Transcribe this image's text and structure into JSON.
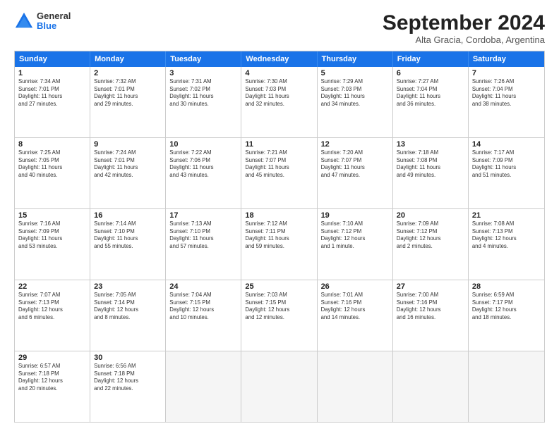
{
  "logo": {
    "general": "General",
    "blue": "Blue"
  },
  "title": "September 2024",
  "subtitle": "Alta Gracia, Cordoba, Argentina",
  "header_days": [
    "Sunday",
    "Monday",
    "Tuesday",
    "Wednesday",
    "Thursday",
    "Friday",
    "Saturday"
  ],
  "weeks": [
    [
      {
        "day": "1",
        "lines": [
          "Sunrise: 7:34 AM",
          "Sunset: 7:01 PM",
          "Daylight: 11 hours",
          "and 27 minutes."
        ]
      },
      {
        "day": "2",
        "lines": [
          "Sunrise: 7:32 AM",
          "Sunset: 7:01 PM",
          "Daylight: 11 hours",
          "and 29 minutes."
        ]
      },
      {
        "day": "3",
        "lines": [
          "Sunrise: 7:31 AM",
          "Sunset: 7:02 PM",
          "Daylight: 11 hours",
          "and 30 minutes."
        ]
      },
      {
        "day": "4",
        "lines": [
          "Sunrise: 7:30 AM",
          "Sunset: 7:03 PM",
          "Daylight: 11 hours",
          "and 32 minutes."
        ]
      },
      {
        "day": "5",
        "lines": [
          "Sunrise: 7:29 AM",
          "Sunset: 7:03 PM",
          "Daylight: 11 hours",
          "and 34 minutes."
        ]
      },
      {
        "day": "6",
        "lines": [
          "Sunrise: 7:27 AM",
          "Sunset: 7:04 PM",
          "Daylight: 11 hours",
          "and 36 minutes."
        ]
      },
      {
        "day": "7",
        "lines": [
          "Sunrise: 7:26 AM",
          "Sunset: 7:04 PM",
          "Daylight: 11 hours",
          "and 38 minutes."
        ]
      }
    ],
    [
      {
        "day": "8",
        "lines": [
          "Sunrise: 7:25 AM",
          "Sunset: 7:05 PM",
          "Daylight: 11 hours",
          "and 40 minutes."
        ]
      },
      {
        "day": "9",
        "lines": [
          "Sunrise: 7:24 AM",
          "Sunset: 7:01 PM",
          "Daylight: 11 hours",
          "and 42 minutes."
        ]
      },
      {
        "day": "10",
        "lines": [
          "Sunrise: 7:22 AM",
          "Sunset: 7:06 PM",
          "Daylight: 11 hours",
          "and 43 minutes."
        ]
      },
      {
        "day": "11",
        "lines": [
          "Sunrise: 7:21 AM",
          "Sunset: 7:07 PM",
          "Daylight: 11 hours",
          "and 45 minutes."
        ]
      },
      {
        "day": "12",
        "lines": [
          "Sunrise: 7:20 AM",
          "Sunset: 7:07 PM",
          "Daylight: 11 hours",
          "and 47 minutes."
        ]
      },
      {
        "day": "13",
        "lines": [
          "Sunrise: 7:18 AM",
          "Sunset: 7:08 PM",
          "Daylight: 11 hours",
          "and 49 minutes."
        ]
      },
      {
        "day": "14",
        "lines": [
          "Sunrise: 7:17 AM",
          "Sunset: 7:09 PM",
          "Daylight: 11 hours",
          "and 51 minutes."
        ]
      }
    ],
    [
      {
        "day": "15",
        "lines": [
          "Sunrise: 7:16 AM",
          "Sunset: 7:09 PM",
          "Daylight: 11 hours",
          "and 53 minutes."
        ]
      },
      {
        "day": "16",
        "lines": [
          "Sunrise: 7:14 AM",
          "Sunset: 7:10 PM",
          "Daylight: 11 hours",
          "and 55 minutes."
        ]
      },
      {
        "day": "17",
        "lines": [
          "Sunrise: 7:13 AM",
          "Sunset: 7:10 PM",
          "Daylight: 11 hours",
          "and 57 minutes."
        ]
      },
      {
        "day": "18",
        "lines": [
          "Sunrise: 7:12 AM",
          "Sunset: 7:11 PM",
          "Daylight: 11 hours",
          "and 59 minutes."
        ]
      },
      {
        "day": "19",
        "lines": [
          "Sunrise: 7:10 AM",
          "Sunset: 7:12 PM",
          "Daylight: 12 hours",
          "and 1 minute."
        ]
      },
      {
        "day": "20",
        "lines": [
          "Sunrise: 7:09 AM",
          "Sunset: 7:12 PM",
          "Daylight: 12 hours",
          "and 2 minutes."
        ]
      },
      {
        "day": "21",
        "lines": [
          "Sunrise: 7:08 AM",
          "Sunset: 7:13 PM",
          "Daylight: 12 hours",
          "and 4 minutes."
        ]
      }
    ],
    [
      {
        "day": "22",
        "lines": [
          "Sunrise: 7:07 AM",
          "Sunset: 7:13 PM",
          "Daylight: 12 hours",
          "and 6 minutes."
        ]
      },
      {
        "day": "23",
        "lines": [
          "Sunrise: 7:05 AM",
          "Sunset: 7:14 PM",
          "Daylight: 12 hours",
          "and 8 minutes."
        ]
      },
      {
        "day": "24",
        "lines": [
          "Sunrise: 7:04 AM",
          "Sunset: 7:15 PM",
          "Daylight: 12 hours",
          "and 10 minutes."
        ]
      },
      {
        "day": "25",
        "lines": [
          "Sunrise: 7:03 AM",
          "Sunset: 7:15 PM",
          "Daylight: 12 hours",
          "and 12 minutes."
        ]
      },
      {
        "day": "26",
        "lines": [
          "Sunrise: 7:01 AM",
          "Sunset: 7:16 PM",
          "Daylight: 12 hours",
          "and 14 minutes."
        ]
      },
      {
        "day": "27",
        "lines": [
          "Sunrise: 7:00 AM",
          "Sunset: 7:16 PM",
          "Daylight: 12 hours",
          "and 16 minutes."
        ]
      },
      {
        "day": "28",
        "lines": [
          "Sunrise: 6:59 AM",
          "Sunset: 7:17 PM",
          "Daylight: 12 hours",
          "and 18 minutes."
        ]
      }
    ],
    [
      {
        "day": "29",
        "lines": [
          "Sunrise: 6:57 AM",
          "Sunset: 7:18 PM",
          "Daylight: 12 hours",
          "and 20 minutes."
        ]
      },
      {
        "day": "30",
        "lines": [
          "Sunrise: 6:56 AM",
          "Sunset: 7:18 PM",
          "Daylight: 12 hours",
          "and 22 minutes."
        ]
      },
      {
        "day": "",
        "lines": []
      },
      {
        "day": "",
        "lines": []
      },
      {
        "day": "",
        "lines": []
      },
      {
        "day": "",
        "lines": []
      },
      {
        "day": "",
        "lines": []
      }
    ]
  ]
}
